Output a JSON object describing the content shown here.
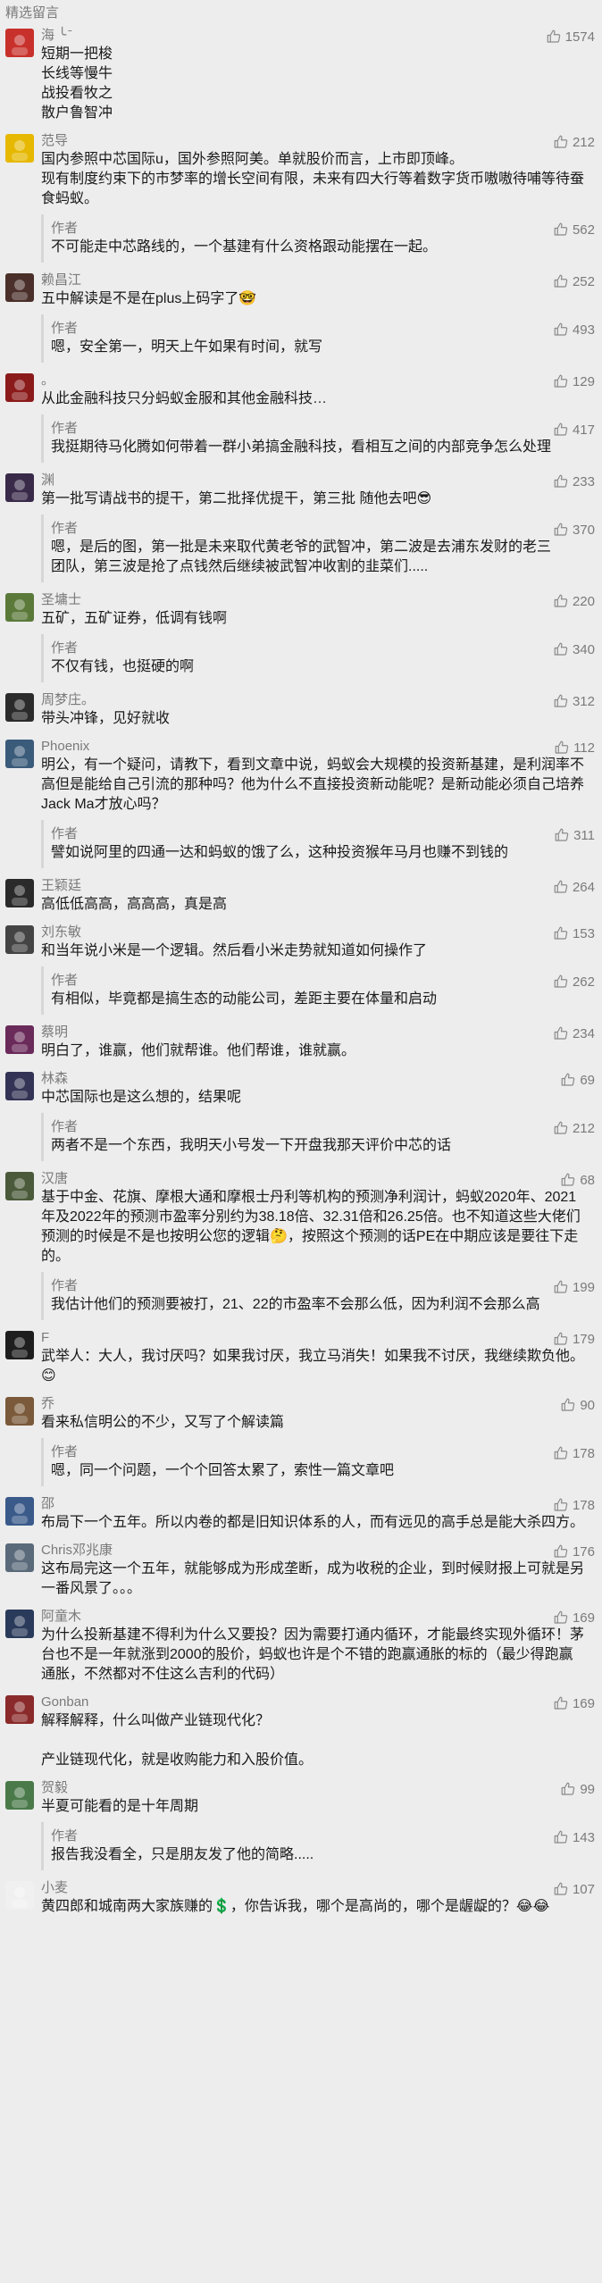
{
  "header": {
    "title": "精选留言"
  },
  "comments": [
    {
      "nick": "海 ╰ ̄",
      "body": "短期一把梭\n长线等慢牛\n战投看牧之\n散户鲁智冲",
      "likes": "1574",
      "avatar_color": "#c8312b"
    },
    {
      "nick": "范导",
      "body": "国内参照中芯国际u，国外参照阿美。单就股价而言，上市即顶峰。\n现有制度约束下的市梦率的增长空间有限，未来有四大行等着数字货币嗷嗷待哺等待蚕食蚂蚁。",
      "likes": "212",
      "avatar_color": "#e6b800",
      "reply": {
        "author": "作者",
        "body": "不可能走中芯路线的，一个基建有什么资格跟动能摆在一起。",
        "likes": "562"
      }
    },
    {
      "nick": "赖昌江",
      "body": "五中解读是不是在plus上码字了🤓",
      "likes": "252",
      "avatar_color": "#4a2f2a",
      "reply": {
        "author": "作者",
        "body": "嗯，安全第一，明天上午如果有时间，就写",
        "likes": "493"
      }
    },
    {
      "nick": "。",
      "body": "从此金融科技只分蚂蚁金服和其他金融科技…",
      "likes": "129",
      "avatar_color": "#8b1a1a",
      "reply": {
        "author": "作者",
        "body": "我挺期待马化腾如何带着一群小弟搞金融科技，看相互之间的内部竞争怎么处理",
        "likes": "417"
      }
    },
    {
      "nick": "渊",
      "body": "第一批写请战书的提干，第二批择优提干，第三批 随他去吧😎",
      "likes": "233",
      "avatar_color": "#3a2a4a",
      "reply": {
        "author": "作者",
        "body": "嗯，是后的图，第一批是未来取代黄老爷的武智冲，第二波是去浦东发财的老三团队，第三波是抢了点钱然后继续被武智冲收割的韭菜们.....",
        "likes": "370"
      }
    },
    {
      "nick": "圣墉士",
      "body": "五矿，五矿证券，低调有钱啊",
      "likes": "220",
      "avatar_color": "#5b7a3a",
      "reply": {
        "author": "作者",
        "body": "不仅有钱，也挺硬的啊",
        "likes": "340"
      }
    },
    {
      "nick": "周梦庄。",
      "body": "带头冲锋，见好就收",
      "likes": "312",
      "avatar_color": "#2b2b2b"
    },
    {
      "nick": "Phoenix",
      "body": "明公，有一个疑问，请教下，看到文章中说，蚂蚁会大规模的投资新基建，是利润率不高但是能给自己引流的那种吗？他为什么不直接投资新动能呢？是新动能必须自己培养Jack Ma才放心吗？",
      "likes": "112",
      "avatar_color": "#3b5b7a",
      "reply": {
        "author": "作者",
        "body": "譬如说阿里的四通一达和蚂蚁的饿了么，这种投资猴年马月也赚不到钱的",
        "likes": "311"
      }
    },
    {
      "nick": "王颖廷",
      "body": "高低低高高，高高高，真是高",
      "likes": "264",
      "avatar_color": "#2a2a2a"
    },
    {
      "nick": "刘东敏",
      "body": "和当年说小米是一个逻辑。然后看小米走势就知道如何操作了",
      "likes": "153",
      "avatar_color": "#444444",
      "reply": {
        "author": "作者",
        "body": "有相似，毕竟都是搞生态的动能公司，差距主要在体量和启动",
        "likes": "262"
      }
    },
    {
      "nick": "蔡明",
      "body": "明白了，谁赢，他们就帮谁。他们帮谁，谁就赢。",
      "likes": "234",
      "avatar_color": "#6a2a5a"
    },
    {
      "nick": "林森",
      "body": "中芯国际也是这么想的，结果呢",
      "likes": "69",
      "avatar_color": "#333355",
      "reply": {
        "author": "作者",
        "body": "两者不是一个东西，我明天小号发一下开盘我那天评价中芯的话",
        "likes": "212"
      }
    },
    {
      "nick": "汉唐",
      "body": "基于中金、花旗、摩根大通和摩根士丹利等机构的预测净利润计，蚂蚁2020年、2021年及2022年的预测市盈率分别约为38.18倍、32.31倍和26.25倍。也不知道这些大佬们预测的时候是不是也按明公您的逻辑🤔，按照这个预测的话PE在中期应该是要往下走的。",
      "likes": "68",
      "avatar_color": "#4a5a3a",
      "reply": {
        "author": "作者",
        "body": "我估计他们的预测要被打，21、22的市盈率不会那么低，因为利润不会那么高",
        "likes": "199"
      }
    },
    {
      "nick": "F",
      "body": "武举人：大人，我讨厌吗？如果我讨厌，我立马消失！如果我不讨厌，我继续欺负他。😊",
      "likes": "179",
      "avatar_color": "#1e1e1e"
    },
    {
      "nick": "乔",
      "body": "看来私信明公的不少，又写了个解读篇",
      "likes": "90",
      "avatar_color": "#7a5a3a",
      "reply": {
        "author": "作者",
        "body": "嗯，同一个问题，一个个回答太累了，索性一篇文章吧",
        "likes": "178"
      }
    },
    {
      "nick": "邵",
      "body": "布局下一个五年。所以内卷的都是旧知识体系的人，而有远见的高手总是能大杀四方。",
      "likes": "178",
      "avatar_color": "#3a5a8a"
    },
    {
      "nick": "Chris邓兆康",
      "body": "这布局完这一个五年，就能够成为形成垄断，成为收税的企业，到时候财报上可就是另一番风景了。。。",
      "likes": "176",
      "avatar_color": "#5a6a7a"
    },
    {
      "nick": "阿童木",
      "body": "为什么投新基建不得利为什么又要投？因为需要打通内循环，才能最终实现外循环！茅台也不是一年就涨到2000的股价，蚂蚁也许是个不错的跑赢通胀的标的（最少得跑赢通胀，不然都对不住这么吉利的代码）",
      "likes": "169",
      "avatar_color": "#2a3a5a"
    },
    {
      "nick": "Gonban",
      "body": "解释解释，什么叫做产业链现代化？\n\n产业链现代化，就是收购能力和入股价值。",
      "likes": "169",
      "avatar_color": "#8a2a2a"
    },
    {
      "nick": "贺毅",
      "body": "半夏可能看的是十年周期",
      "likes": "99",
      "avatar_color": "#4a7a4a",
      "reply": {
        "author": "作者",
        "body": "报告我没看全，只是朋友发了他的简略.....",
        "likes": "143"
      }
    },
    {
      "nick": "小麦",
      "body": "黄四郎和城南两大家族赚的💲，你告诉我，哪个是高尚的，哪个是龌龊的？😂😂",
      "likes": "107",
      "avatar_color": "#f0f0f0"
    }
  ]
}
